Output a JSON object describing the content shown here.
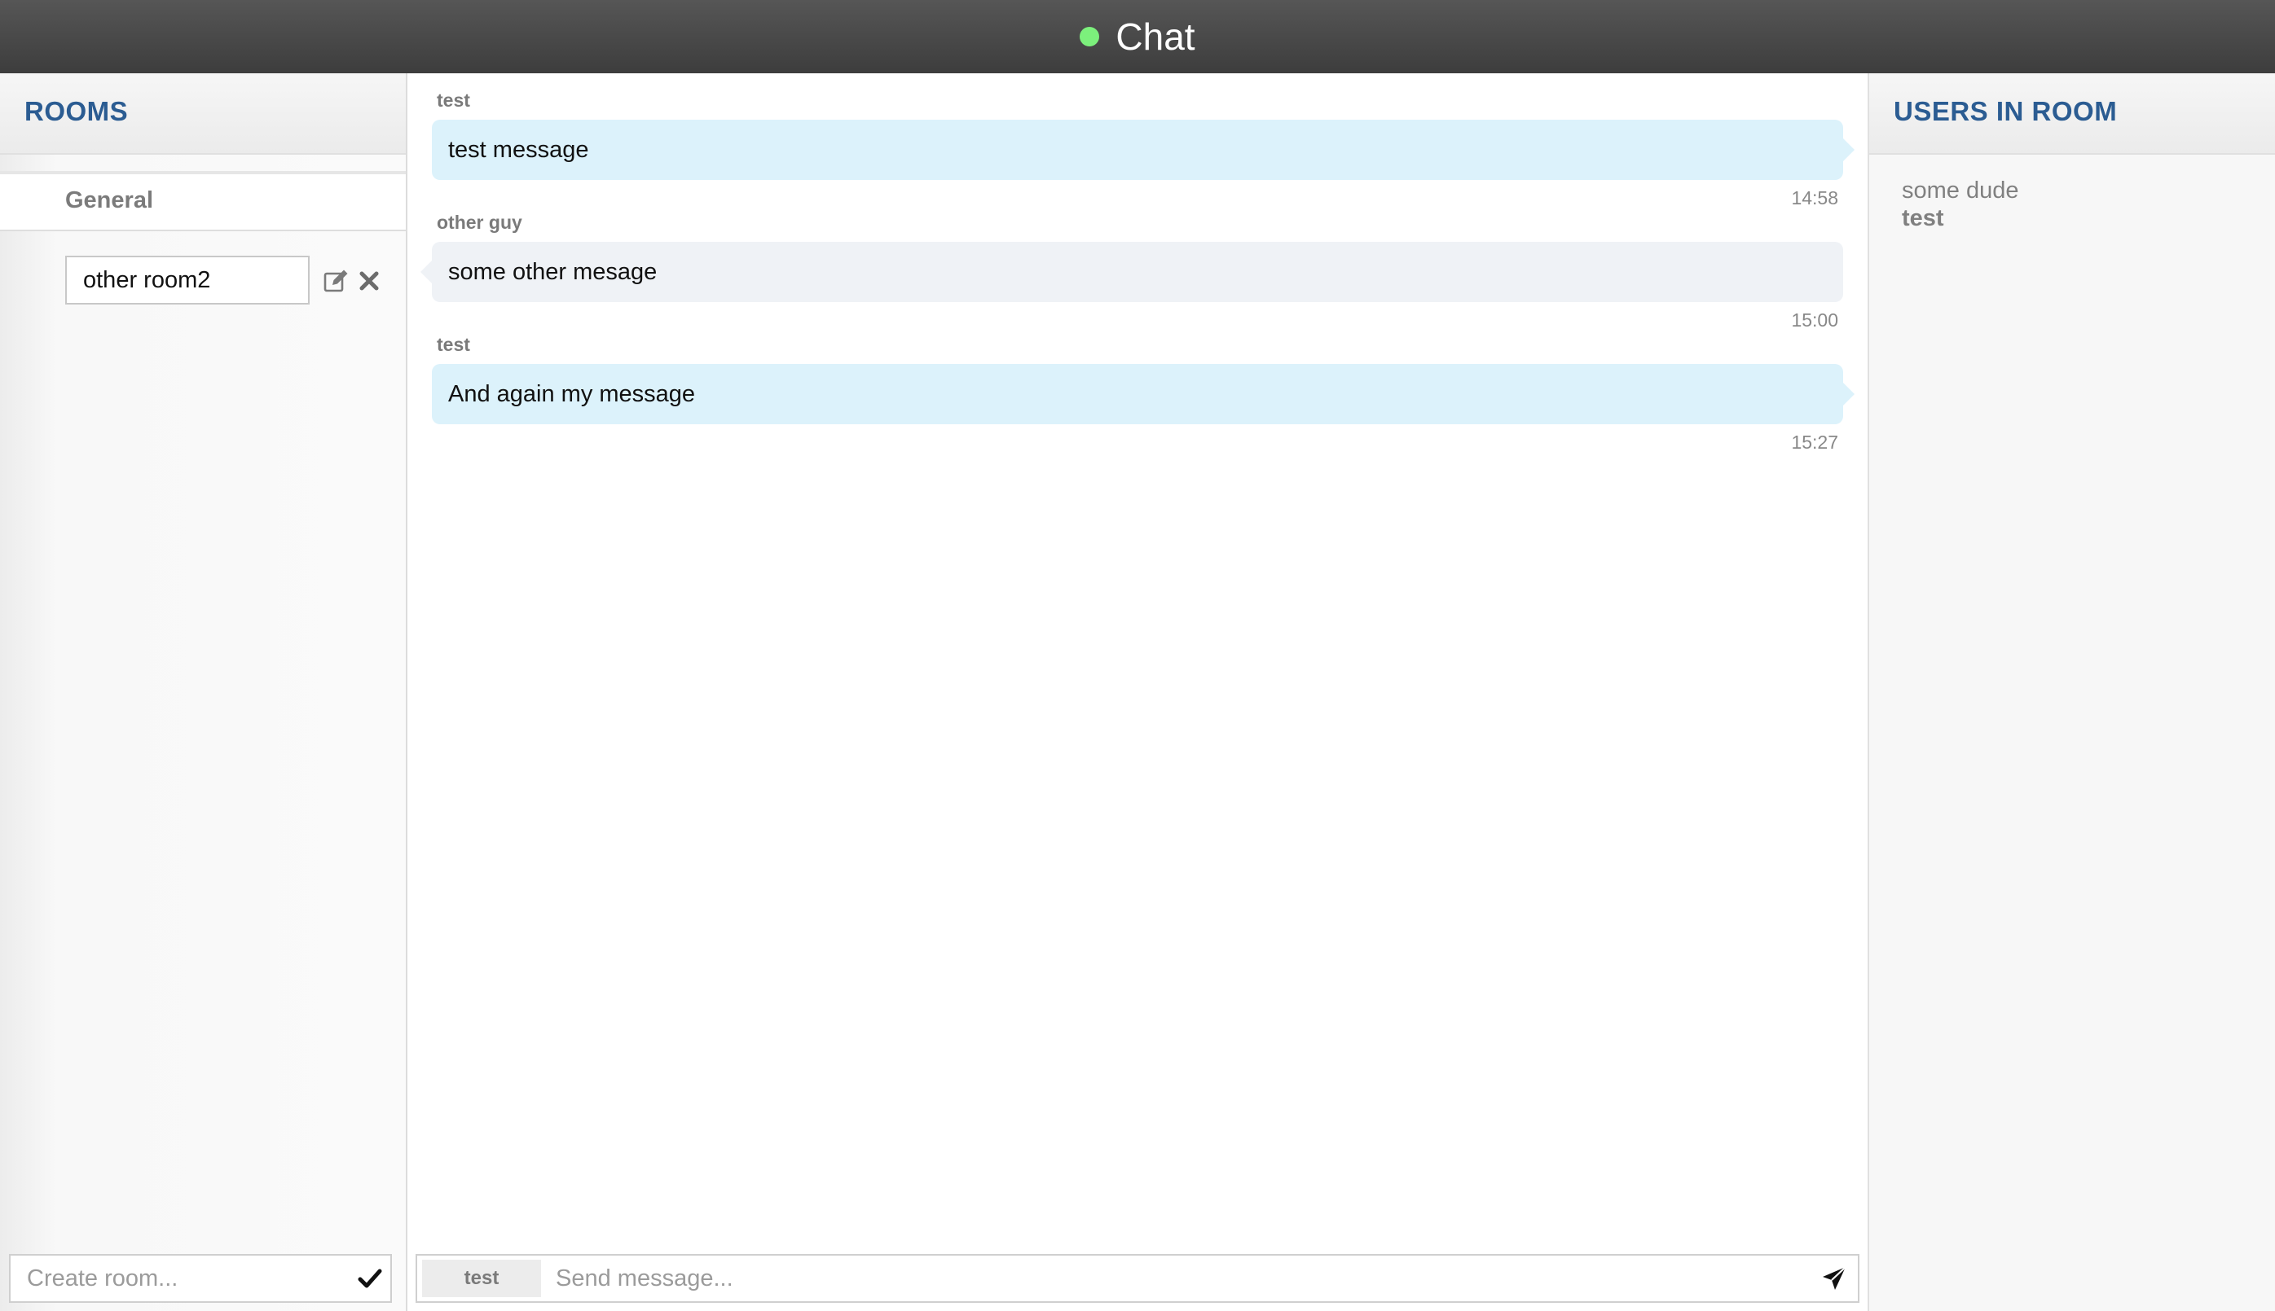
{
  "header": {
    "title": "Chat",
    "status_color": "#7cf07c"
  },
  "colors": {
    "accent": "#2b5c92",
    "own_bubble": "#dcf2fb",
    "other_bubble": "#eff2f6"
  },
  "rooms": {
    "title": "ROOMS",
    "active_room": "General",
    "editing_room": {
      "value": "other room2",
      "actions": [
        "edit-icon",
        "close-icon"
      ]
    },
    "create": {
      "placeholder": "Create room...",
      "submit_icon": "checkmark-icon"
    }
  },
  "messages": [
    {
      "author": "test",
      "text": "test message",
      "time": "14:58",
      "own": true
    },
    {
      "author": "other guy",
      "text": "some other mesage",
      "time": "15:00",
      "own": false
    },
    {
      "author": "test",
      "text": "And again my message",
      "time": "15:27",
      "own": true
    }
  ],
  "composer": {
    "user": "test",
    "placeholder": "Send message...",
    "send_icon": "send-icon"
  },
  "users_panel": {
    "title": "USERS IN ROOM",
    "users": [
      {
        "name": "some dude",
        "current": false
      },
      {
        "name": "test",
        "current": true
      }
    ]
  }
}
